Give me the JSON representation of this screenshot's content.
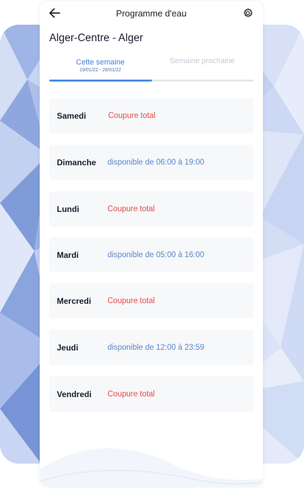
{
  "header": {
    "title": "Programme d'eau",
    "back_icon": "arrow-left-icon",
    "settings_icon": "gear-icon"
  },
  "location": "Alger-Centre - Alger",
  "tabs": [
    {
      "label": "Cette semaine",
      "dates": "19/01/22 - 26/01/22",
      "active": true
    },
    {
      "label": "Semaine prochaine",
      "dates": "",
      "active": false
    }
  ],
  "days": [
    {
      "name": "Samedi",
      "status": "Coupure total",
      "available": false
    },
    {
      "name": "Dimanche",
      "status": "disponible de 06:00 à 19:00",
      "available": true
    },
    {
      "name": "Lundi",
      "status": "Coupure total",
      "available": false
    },
    {
      "name": "Mardi",
      "status": "disponible de 05:00 à 16:00",
      "available": true
    },
    {
      "name": "Mercredi",
      "status": "Coupure total",
      "available": false
    },
    {
      "name": "Jeudi",
      "status": "disponible de 12:00 à 23:59",
      "available": true
    },
    {
      "name": "Vendredi",
      "status": "Coupure total",
      "available": false
    }
  ],
  "colors": {
    "accent": "#4b8ee7",
    "cut": "#e24b4b",
    "available": "#5b86c8",
    "row_bg": "#f7f8fa"
  }
}
